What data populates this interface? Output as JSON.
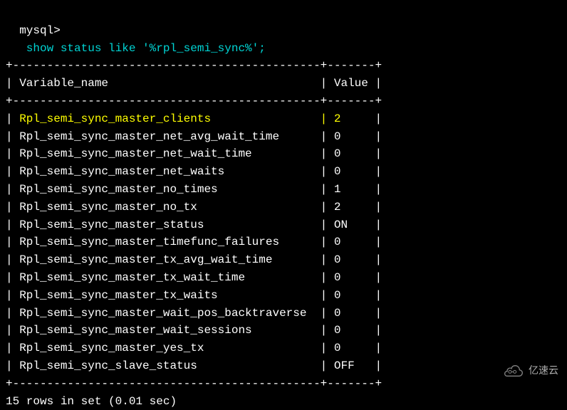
{
  "prompt": "mysql>",
  "command": " show status like '%rpl_semi_sync%';",
  "divider_top": "+---------------------------------------------+-------+",
  "header": {
    "col1": "Variable_name",
    "col2": "Value"
  },
  "rows": [
    {
      "name": "Rpl_semi_sync_master_clients",
      "value": "2",
      "highlight": true
    },
    {
      "name": "Rpl_semi_sync_master_net_avg_wait_time",
      "value": "0",
      "highlight": false
    },
    {
      "name": "Rpl_semi_sync_master_net_wait_time",
      "value": "0",
      "highlight": false
    },
    {
      "name": "Rpl_semi_sync_master_net_waits",
      "value": "0",
      "highlight": false
    },
    {
      "name": "Rpl_semi_sync_master_no_times",
      "value": "1",
      "highlight": false
    },
    {
      "name": "Rpl_semi_sync_master_no_tx",
      "value": "2",
      "highlight": false
    },
    {
      "name": "Rpl_semi_sync_master_status",
      "value": "ON",
      "highlight": false
    },
    {
      "name": "Rpl_semi_sync_master_timefunc_failures",
      "value": "0",
      "highlight": false
    },
    {
      "name": "Rpl_semi_sync_master_tx_avg_wait_time",
      "value": "0",
      "highlight": false
    },
    {
      "name": "Rpl_semi_sync_master_tx_wait_time",
      "value": "0",
      "highlight": false
    },
    {
      "name": "Rpl_semi_sync_master_tx_waits",
      "value": "0",
      "highlight": false
    },
    {
      "name": "Rpl_semi_sync_master_wait_pos_backtraverse",
      "value": "0",
      "highlight": false
    },
    {
      "name": "Rpl_semi_sync_master_wait_sessions",
      "value": "0",
      "highlight": false
    },
    {
      "name": "Rpl_semi_sync_master_yes_tx",
      "value": "0",
      "highlight": false
    },
    {
      "name": "Rpl_semi_sync_slave_status",
      "value": "OFF",
      "highlight": false
    }
  ],
  "footer": "15 rows in set (0.01 sec)",
  "watermark": "亿速云",
  "col1_width": 43,
  "col2_width": 5
}
